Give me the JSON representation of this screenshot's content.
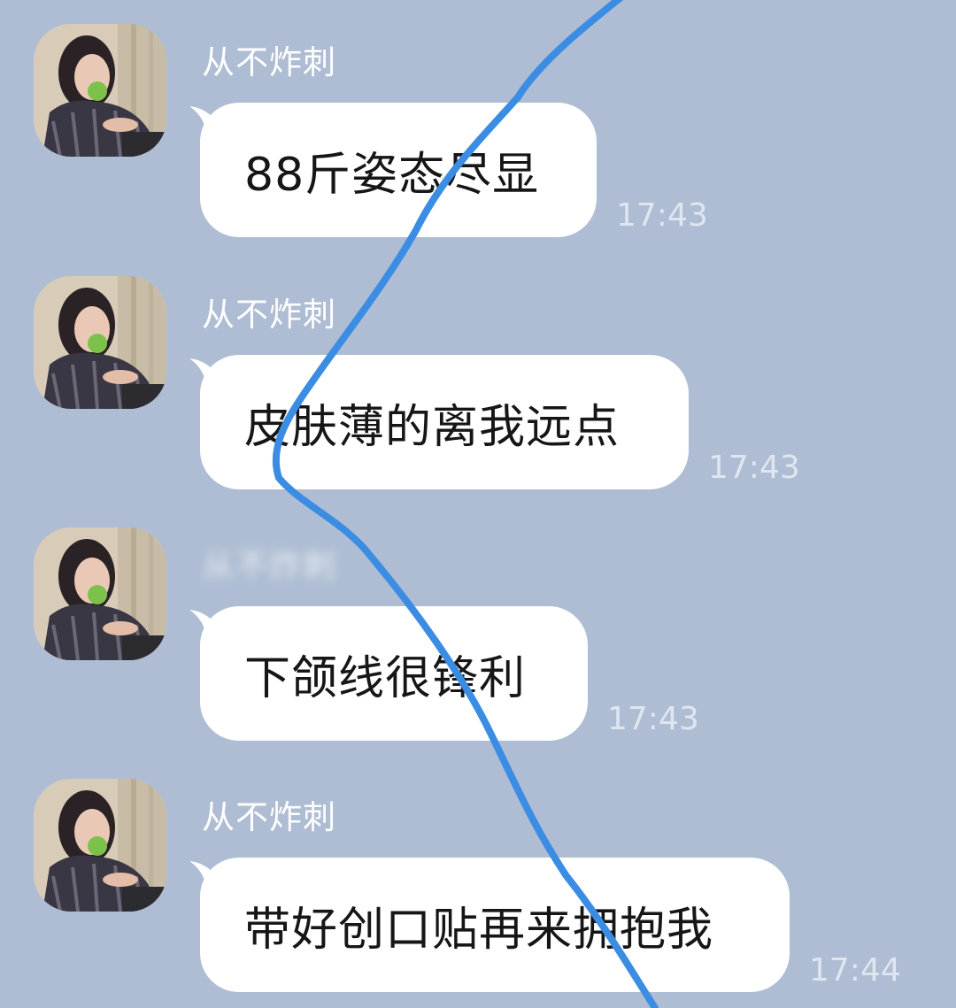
{
  "messages": [
    {
      "sender": "从不炸刺",
      "text": "88斤姿态尽显",
      "time": "17:43"
    },
    {
      "sender": "从不炸刺",
      "text": "皮肤薄的离我远点",
      "time": "17:43"
    },
    {
      "sender": "从不炸刺",
      "text": "下颌线很锋利",
      "time": "17:43"
    },
    {
      "sender": "从不炸刺",
      "text": "带好创口贴再来拥抱我",
      "time": "17:44"
    }
  ],
  "colors": {
    "background": "#aebdd3",
    "bubble": "#ffffff",
    "annotation_stroke": "#3b8de3"
  },
  "icons": {
    "avatar": "user-photo-avatar"
  }
}
